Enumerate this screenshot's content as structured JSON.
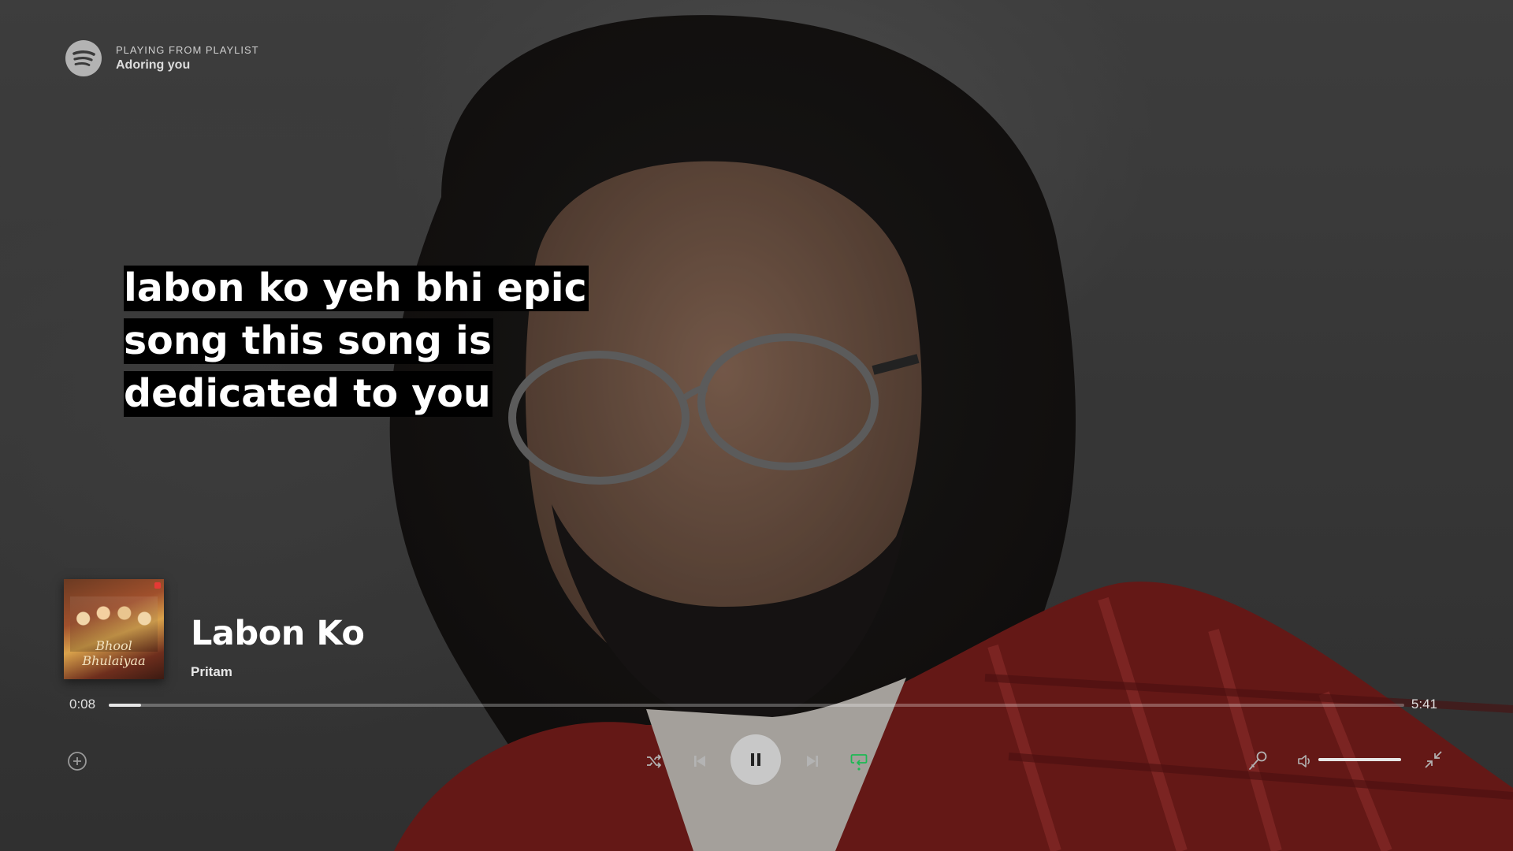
{
  "header": {
    "kicker": "PLAYING FROM PLAYLIST",
    "playlist_name": "Adoring you"
  },
  "lyrics": {
    "lines": [
      " labon ko yeh bhi epic",
      "song this song is",
      "dedicated to you"
    ]
  },
  "now_playing": {
    "title": "Labon Ko",
    "artist": "Pritam",
    "album_art_text": "Bhool Bhulaiyaa"
  },
  "playback": {
    "elapsed": "0:08",
    "duration": "5:41",
    "progress_fraction": 0.025,
    "volume_fraction": 1.0,
    "repeat_active": true,
    "state": "playing"
  },
  "icons": {
    "logo": "spotify-icon",
    "add": "add-circle-icon",
    "shuffle": "shuffle-icon",
    "previous": "skip-previous-icon",
    "pause": "pause-icon",
    "next": "skip-next-icon",
    "repeat": "repeat-icon",
    "lyrics": "microphone-icon",
    "volume": "volume-icon",
    "fullscreen": "exit-fullscreen-icon"
  },
  "colors": {
    "accent_green": "#1db954",
    "icon_gray": "#b3b3b3",
    "lyric_highlight": "#000000"
  }
}
